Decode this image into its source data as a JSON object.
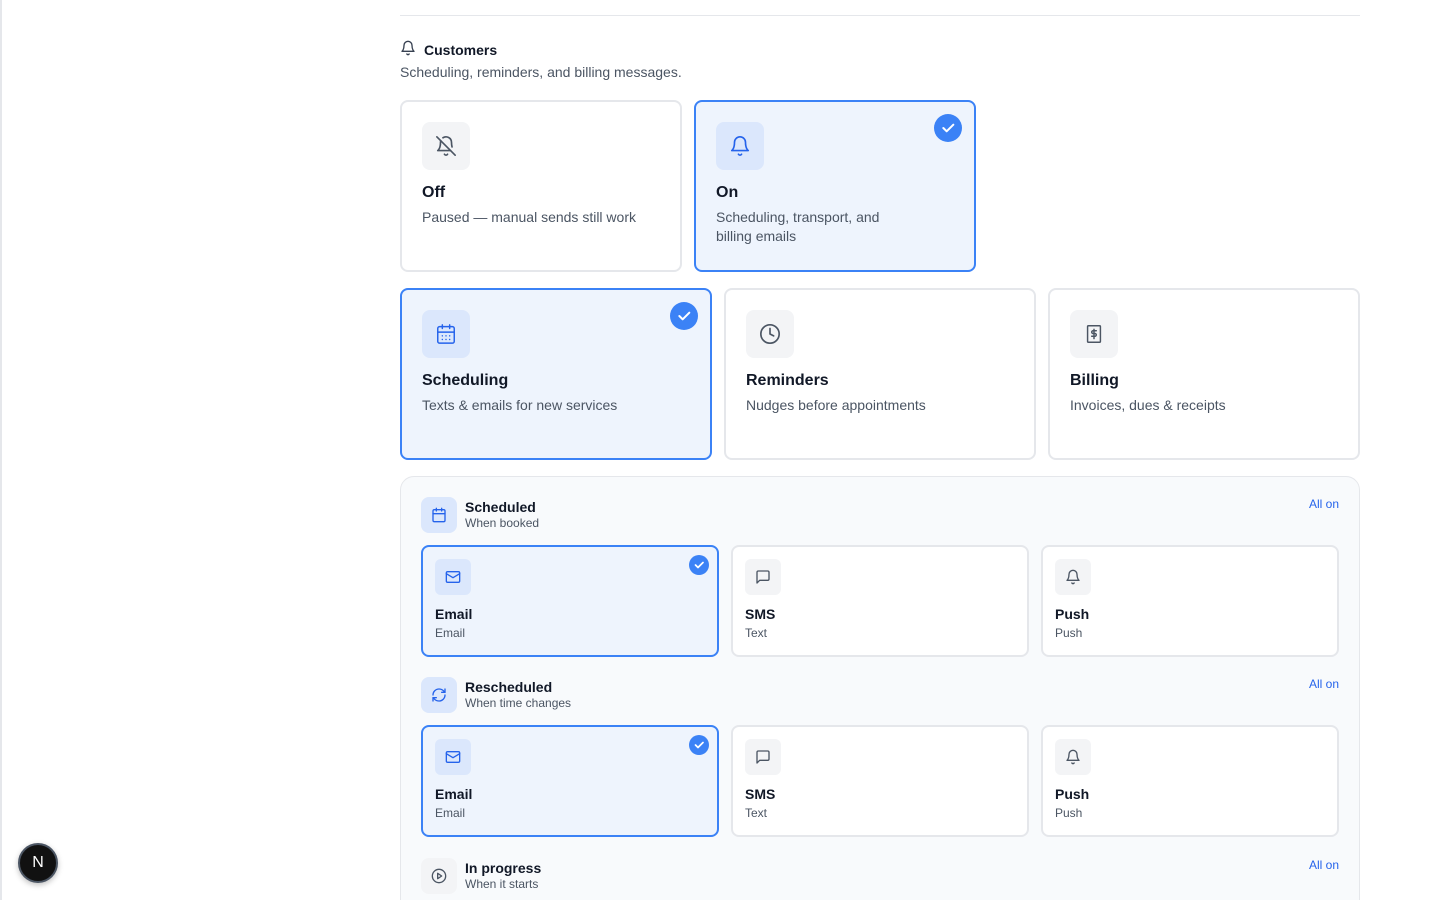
{
  "section": {
    "title": "Customers",
    "description": "Scheduling, reminders, and billing messages."
  },
  "mode_options": [
    {
      "title": "Off",
      "description": "Paused — manual sends still work",
      "selected": false,
      "icon": "bell-off-icon"
    },
    {
      "title": "On",
      "description": "Scheduling, transport, and billing emails",
      "selected": true,
      "icon": "bell-icon"
    }
  ],
  "categories": [
    {
      "title": "Scheduling",
      "description": "Texts & emails for new services",
      "selected": true,
      "icon": "calendar-icon"
    },
    {
      "title": "Reminders",
      "description": "Nudges before appointments",
      "selected": false,
      "icon": "clock-icon"
    },
    {
      "title": "Billing",
      "description": "Invoices, dues & receipts",
      "selected": false,
      "icon": "receipt-icon"
    }
  ],
  "events": [
    {
      "title": "Scheduled",
      "subtitle": "When booked",
      "icon": "calendar-icon",
      "all_on_label": "All on",
      "channels": [
        {
          "title": "Email",
          "subtitle": "Email",
          "selected": true,
          "icon": "mail-icon"
        },
        {
          "title": "SMS",
          "subtitle": "Text",
          "selected": false,
          "icon": "message-icon"
        },
        {
          "title": "Push",
          "subtitle": "Push",
          "selected": false,
          "icon": "bell-icon"
        }
      ]
    },
    {
      "title": "Rescheduled",
      "subtitle": "When time changes",
      "icon": "refresh-icon",
      "all_on_label": "All on",
      "channels": [
        {
          "title": "Email",
          "subtitle": "Email",
          "selected": true,
          "icon": "mail-icon"
        },
        {
          "title": "SMS",
          "subtitle": "Text",
          "selected": false,
          "icon": "message-icon"
        },
        {
          "title": "Push",
          "subtitle": "Push",
          "selected": false,
          "icon": "bell-icon"
        }
      ]
    },
    {
      "title": "In progress",
      "subtitle": "When it starts",
      "icon": "play-circle-icon",
      "all_on_label": "All on"
    }
  ],
  "dev_badge": {
    "label": "N"
  },
  "colors": {
    "accent": "#3b82f6",
    "selected_bg": "#eef4fd",
    "link": "#2563eb"
  }
}
